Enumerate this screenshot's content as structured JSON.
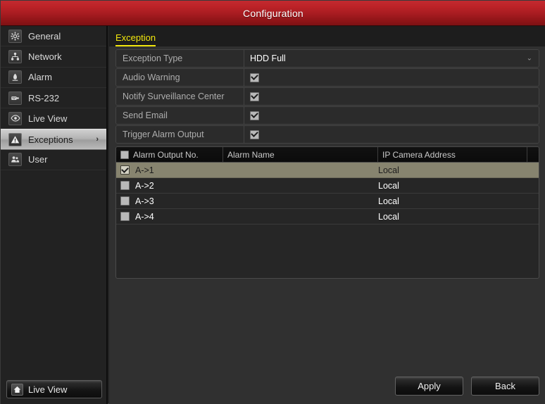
{
  "window": {
    "title": "Configuration"
  },
  "sidebar": {
    "items": [
      {
        "label": "General",
        "icon": "gear-icon",
        "active": false
      },
      {
        "label": "Network",
        "icon": "network-icon",
        "active": false
      },
      {
        "label": "Alarm",
        "icon": "alarm-icon",
        "active": false
      },
      {
        "label": "RS-232",
        "icon": "serial-port-icon",
        "active": false
      },
      {
        "label": "Live View",
        "icon": "eye-icon",
        "active": false
      },
      {
        "label": "Exceptions",
        "icon": "warning-triangle-icon",
        "active": true
      },
      {
        "label": "User",
        "icon": "users-icon",
        "active": false
      }
    ],
    "active_chevron": "›",
    "live_view_button": {
      "label": "Live View",
      "icon": "home-icon"
    }
  },
  "content": {
    "tab": {
      "label": "Exception"
    },
    "settings": [
      {
        "label": "Exception Type",
        "type": "select",
        "value": "HDD Full",
        "chevron": "⌄"
      },
      {
        "label": "Audio Warning",
        "type": "checkbox",
        "checked": true
      },
      {
        "label": "Notify Surveillance Center",
        "type": "checkbox",
        "checked": true
      },
      {
        "label": "Send Email",
        "type": "checkbox",
        "checked": true
      },
      {
        "label": "Trigger Alarm Output",
        "type": "checkbox",
        "checked": true
      }
    ],
    "table": {
      "headers": [
        "Alarm Output No.",
        "Alarm Name",
        "IP Camera Address"
      ],
      "header_checkbox_checked": false,
      "rows": [
        {
          "checked": true,
          "alarm_output_no": "A->1",
          "alarm_name": "",
          "ip_camera_address": "Local",
          "selected": true
        },
        {
          "checked": false,
          "alarm_output_no": "A->2",
          "alarm_name": "",
          "ip_camera_address": "Local",
          "selected": false
        },
        {
          "checked": false,
          "alarm_output_no": "A->3",
          "alarm_name": "",
          "ip_camera_address": "Local",
          "selected": false
        },
        {
          "checked": false,
          "alarm_output_no": "A->4",
          "alarm_name": "",
          "ip_camera_address": "Local",
          "selected": false
        }
      ]
    },
    "footer": {
      "apply_label": "Apply",
      "back_label": "Back"
    }
  },
  "colors": {
    "titlebar_red": "#bd2328",
    "tab_yellow": "#f2e70d",
    "selected_row": "#87846f",
    "panel_bg": "#303030"
  }
}
